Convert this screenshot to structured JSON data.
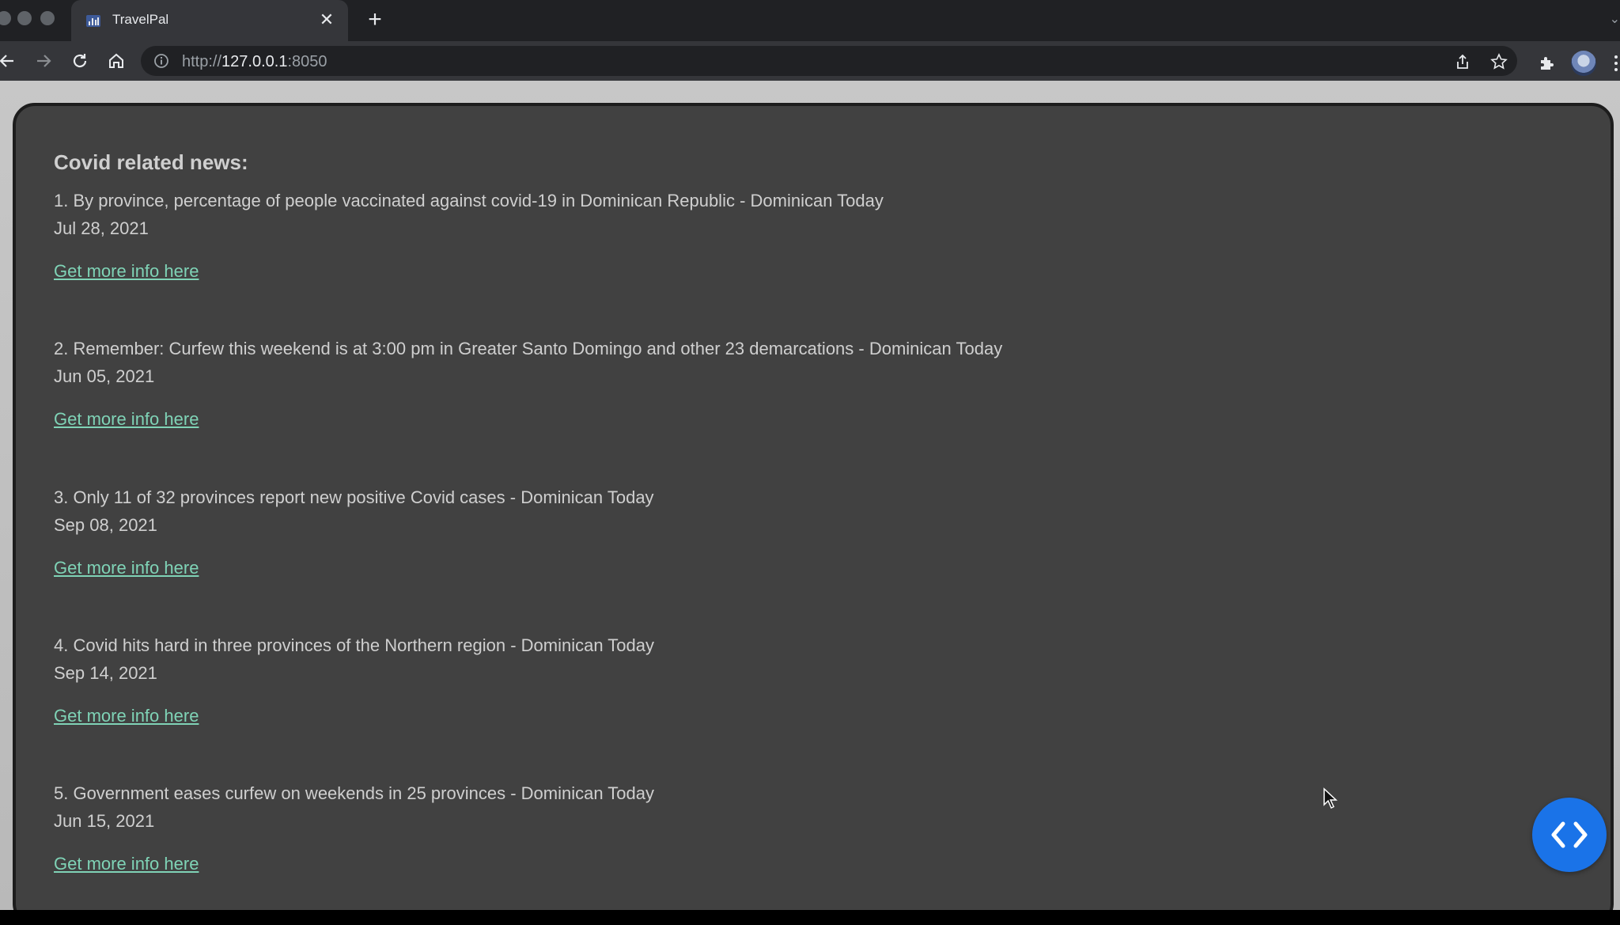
{
  "browser": {
    "tab": {
      "title": "TravelPal",
      "favicon": "bar-chart-icon"
    },
    "url_prefix": "http://",
    "url_host": "127.0.0.1",
    "url_suffix": ":8050"
  },
  "page": {
    "heading": "Covid related news:",
    "link_label": "Get more info here",
    "news": [
      {
        "title": "1. By province, percentage of people vaccinated against covid-19 in Dominican Republic - Dominican Today",
        "date": "Jul 28, 2021"
      },
      {
        "title": "2. Remember: Curfew this weekend is at 3:00 pm in Greater Santo Domingo and other 23 demarcations - Dominican Today",
        "date": "Jun 05, 2021"
      },
      {
        "title": "3. Only 11 of 32 provinces report new positive Covid cases - Dominican Today",
        "date": "Sep 08, 2021"
      },
      {
        "title": "4. Covid hits hard in three provinces of the Northern region - Dominican Today",
        "date": "Sep 14, 2021"
      },
      {
        "title": "5. Government eases curfew on weekends in 25 provinces - Dominican Today",
        "date": "Jun 15, 2021"
      }
    ]
  },
  "colors": {
    "card_bg": "#414141",
    "link": "#7fd3b6",
    "fab": "#1a73e8"
  }
}
